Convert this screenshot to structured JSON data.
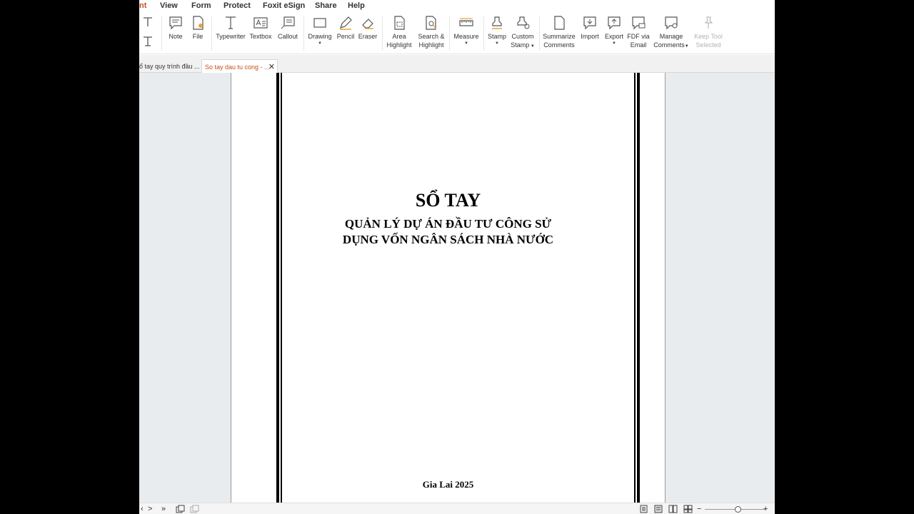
{
  "menu": {
    "partial_tab": "nt",
    "items": [
      "View",
      "Form",
      "Protect",
      "Foxit eSign",
      "Share",
      "Help"
    ]
  },
  "toolbar": {
    "note": "Note",
    "file": "File",
    "typewriter": "Typewriter",
    "textbox": "Textbox",
    "callout": "Callout",
    "drawing": "Drawing",
    "pencil": "Pencil",
    "eraser": "Eraser",
    "area_highlight": [
      "Area",
      "Highlight"
    ],
    "search_highlight": [
      "Search &",
      "Highlight"
    ],
    "measure": "Measure",
    "stamp": "Stamp",
    "custom_stamp": [
      "Custom",
      "Stamp"
    ],
    "summarize_comments": [
      "Summarize",
      "Comments"
    ],
    "import": "Import",
    "export": "Export",
    "fdf_via_email": [
      "FDF via",
      "Email"
    ],
    "manage_comments": [
      "Manage",
      "Comments"
    ],
    "keep_tool_selected": [
      "Keep Tool",
      "Selected"
    ]
  },
  "tabs": [
    {
      "label": "ổ tay quy trình đầu ...",
      "active": false
    },
    {
      "label": "So tay dau tu cong - ...",
      "active": true
    }
  ],
  "tab_close_glyph": "✕",
  "document": {
    "title": "SỔ TAY",
    "subtitle_line1": "QUẢN LÝ DỰ ÁN ĐẦU TƯ CÔNG SỬ",
    "subtitle_line2": "DỤNG VỐN NGÂN SÁCH NHÀ NƯỚC",
    "footer": "Gia Lai 2025"
  },
  "statusbar": {
    "next_glyph": ">",
    "last_glyph": "»",
    "zoom_minus": "−",
    "zoom_plus": "+",
    "zoom_level_fraction": 0.55
  },
  "colors": {
    "accent": "#c4501b",
    "viewer_bg": "#e9ecef"
  }
}
